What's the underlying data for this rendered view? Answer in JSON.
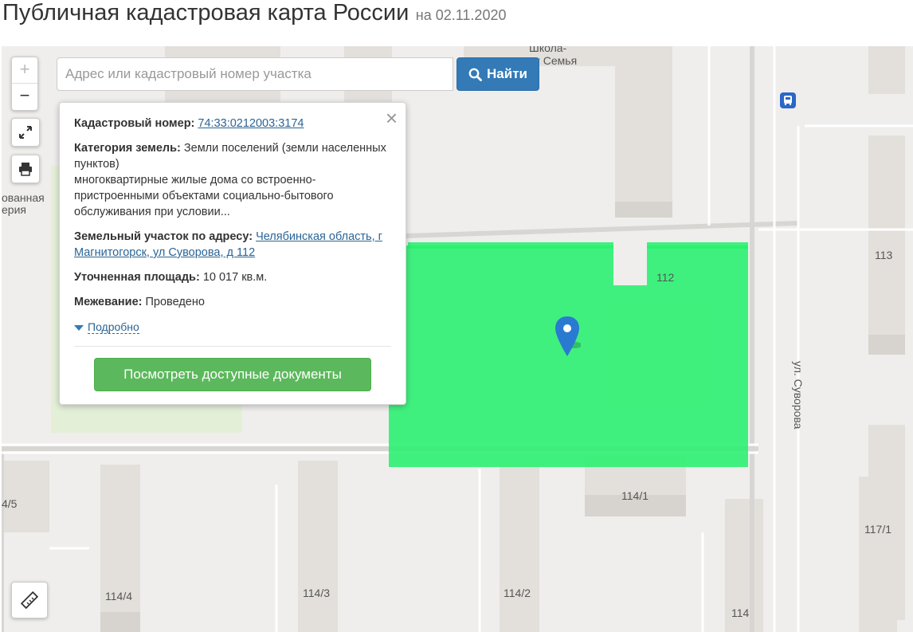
{
  "header": {
    "title": "Публичная кадастровая карта России",
    "date": "на 02.11.2020"
  },
  "search": {
    "placeholder": "Адрес или кадастровый номер участка",
    "value": "",
    "button_label": "Найти"
  },
  "map_controls": {
    "zoom_in": "+",
    "zoom_out": "−"
  },
  "popup": {
    "cadastral_label": "Кадастровый номер:",
    "cadastral_value": "74:33:0212003:3174",
    "category_label": "Категория земель:",
    "category_value": "Земли поселений (земли населенных пунктов)",
    "usage_value": "многоквартирные жилые дома со встроенно-пристроенными объектами социально-бытового обслуживания при условии...",
    "address_label": "Земельный участок по адресу:",
    "address_value": "Челябинская область, г Магнитогорск, ул Суворова, д 112",
    "area_label": "Уточненная площадь:",
    "area_value": "10 017 кв.м.",
    "survey_label": "Межевание:",
    "survey_value": "Проведено",
    "details_link": "Подробно",
    "docs_button": "Посмотреть доступные документы"
  },
  "map_labels": {
    "school": "Школа-",
    "school_sub": "ат Семья",
    "left_cut_1": "ованная",
    "left_cut_2": "ерия",
    "b113": "113",
    "b112": "112",
    "b4_5": "4/5",
    "b114_1": "114/1",
    "b117_1": "117/1",
    "b114_4": "114/4",
    "b114_3": "114/3",
    "b114_2": "114/2",
    "b114": "114",
    "street": "ул. Суворова"
  },
  "colors": {
    "parcel": "#28f06e",
    "search_button": "#337ab7",
    "docs_button": "#5cb85c",
    "marker": "#2a7ad1"
  },
  "icons": {
    "search": "search-icon",
    "fullscreen": "expand-icon",
    "print": "printer-icon",
    "ruler": "ruler-icon",
    "close": "close-icon",
    "marker": "map-marker-icon",
    "bus": "bus-stop-icon"
  }
}
